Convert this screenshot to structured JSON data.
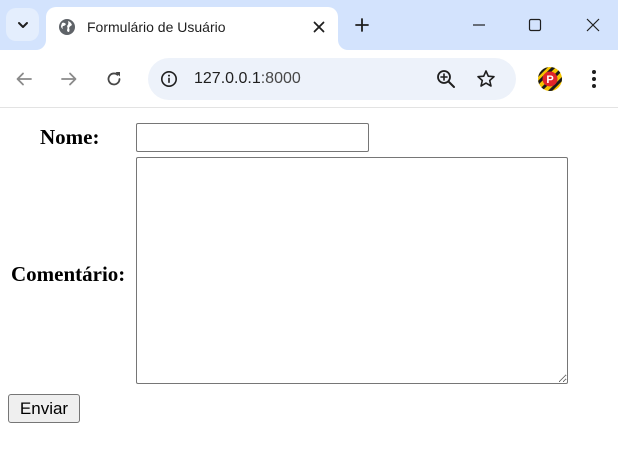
{
  "browser": {
    "tab": {
      "title": "Formulário de Usuário"
    },
    "address": {
      "host": "127.0.0.1",
      "port": ":8000"
    },
    "profile": {
      "initial": "P"
    },
    "colors": {
      "tabstrip": "#d3e3fd",
      "omnibox": "#edf2fa",
      "profile_badge": "#e0242a"
    }
  },
  "form": {
    "nome_label": "Nome:",
    "nome_value": "",
    "comentario_label": "Comentário:",
    "comentario_value": "",
    "submit_label": "Enviar"
  }
}
